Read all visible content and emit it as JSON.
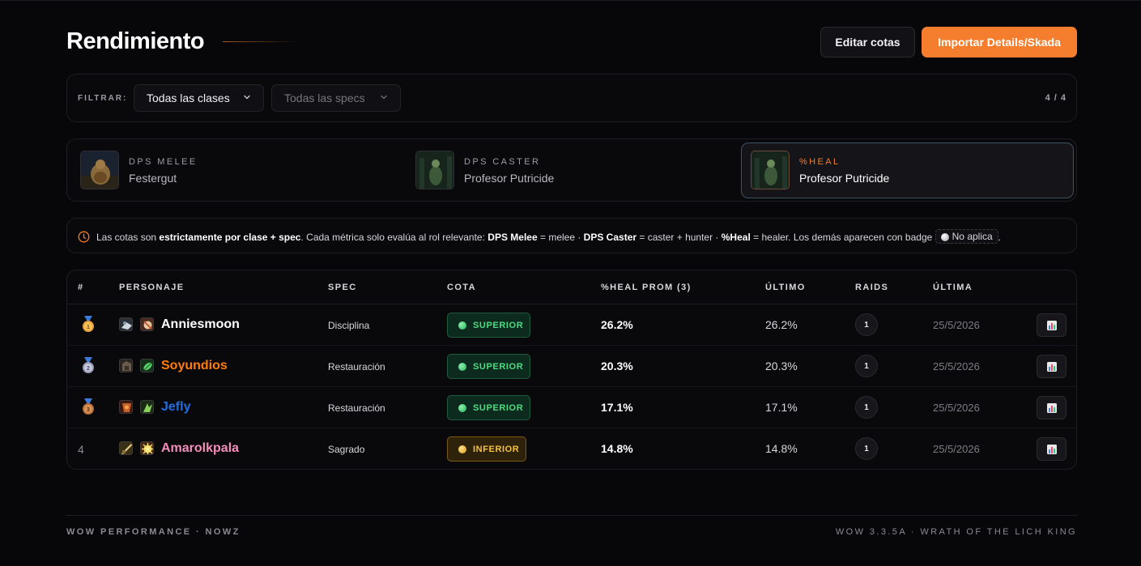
{
  "header": {
    "title": "Rendimiento",
    "edit_button": "Editar cotas",
    "import_button": "Importar Details/Skada"
  },
  "filters": {
    "label": "FILTRAR:",
    "class_select": "Todas las clases",
    "spec_select": "Todas las specs",
    "count": "4 / 4"
  },
  "metrics": [
    {
      "label": "DPS MELEE",
      "boss": "Festergut",
      "icon": "festergut-portrait"
    },
    {
      "label": "DPS CASTER",
      "boss": "Profesor Putricide",
      "icon": "putricide-portrait"
    },
    {
      "label": "%HEAL",
      "boss": "Profesor Putricide",
      "icon": "putricide-portrait",
      "selected": true
    }
  ],
  "note": {
    "t1": "Las cotas son ",
    "b1": "estrictamente por clase + spec",
    "t2": ". Cada métrica solo evalúa al rol relevante: ",
    "b2": "DPS Melee",
    "t3": " = melee · ",
    "b3": "DPS Caster",
    "t4": " = caster + hunter · ",
    "b4": "%Heal",
    "t5": " = healer. Los demás aparecen con badge ",
    "badge": "No aplica",
    "t6": "."
  },
  "table": {
    "headers": {
      "rank": "#",
      "personaje": "PERSONAJE",
      "spec": "SPEC",
      "cota": "COTA",
      "metric": "%HEAL PROM (3)",
      "ultimo": "ÚLTIMO",
      "raids": "RAIDS",
      "ultima": "ÚLTIMA"
    },
    "rows": [
      {
        "rank": "1",
        "name": "Anniesmoon",
        "name_color": "#ffffff",
        "spec": "Disciplina",
        "cota": "SUPERIOR",
        "prom": "26.2%",
        "ultimo": "26.2%",
        "raids": "1",
        "fecha": "25/5/2026"
      },
      {
        "rank": "2",
        "name": "Soyundios",
        "name_color": "#ff7d0a",
        "spec": "Restauración",
        "cota": "SUPERIOR",
        "prom": "20.3%",
        "ultimo": "20.3%",
        "raids": "1",
        "fecha": "25/5/2026"
      },
      {
        "rank": "3",
        "name": "Jefly",
        "name_color": "#1f6fe0",
        "spec": "Restauración",
        "cota": "SUPERIOR",
        "prom": "17.1%",
        "ultimo": "17.1%",
        "raids": "1",
        "fecha": "25/5/2026"
      },
      {
        "rank": "4",
        "name": "Amarolkpala",
        "name_color": "#f58cba",
        "spec": "Sagrado",
        "cota": "INFERIOR",
        "prom": "14.8%",
        "ultimo": "14.8%",
        "raids": "1",
        "fecha": "25/5/2026"
      }
    ]
  },
  "footer": {
    "left": "WOW PERFORMANCE · NOWZ",
    "right": "WOW 3.3.5A · WRATH OF THE LICH KING"
  },
  "colors": {
    "accent": "#f47e2e",
    "superior": "#4ade80",
    "inferior": "#f5c242"
  }
}
